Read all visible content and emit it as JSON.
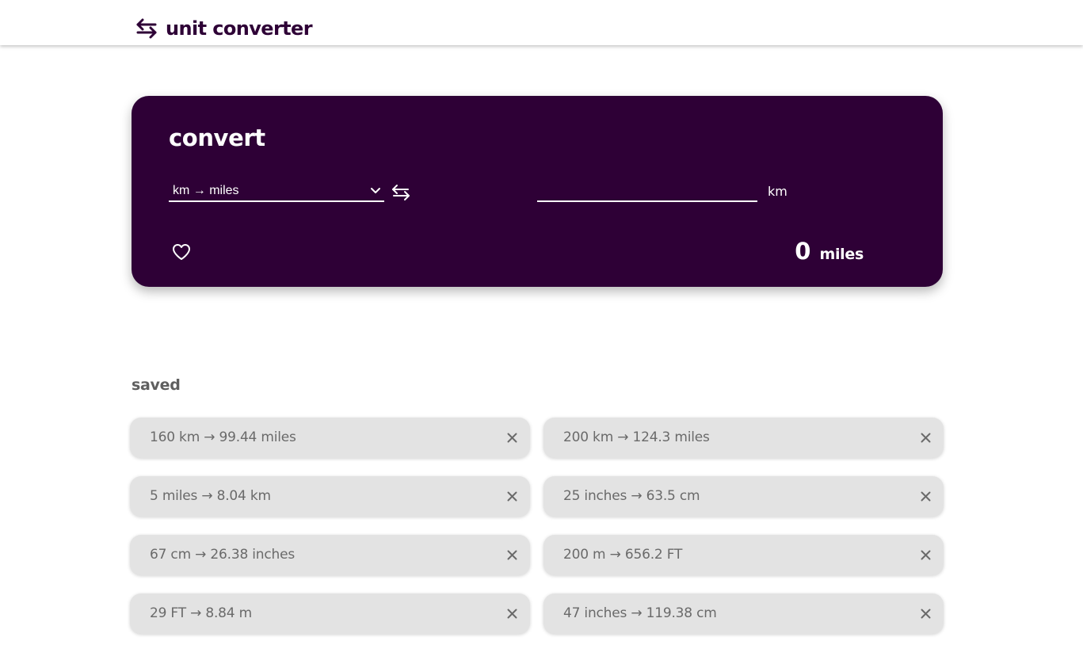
{
  "app": {
    "title": "unit converter",
    "logo_icon": "swap-arrows-icon",
    "brand_color": "#2e0036"
  },
  "converter": {
    "heading": "convert",
    "unit_pair": {
      "selected": "km → miles",
      "options": [
        "km → miles"
      ]
    },
    "swap_icon": "swap-arrows-icon",
    "input": {
      "value": "",
      "placeholder": "",
      "unit": "km"
    },
    "favorite_icon": "heart-outline-icon",
    "result": {
      "value": "0",
      "unit": "miles"
    }
  },
  "saved": {
    "heading": "saved",
    "remove_icon": "close-icon",
    "items": [
      {
        "label": "160 km → 99.44 miles"
      },
      {
        "label": "200 km → 124.3 miles"
      },
      {
        "label": "5 miles → 8.04 km"
      },
      {
        "label": "25 inches → 63.5 cm"
      },
      {
        "label": "67 cm → 26.38 inches"
      },
      {
        "label": "200 m → 656.2 FT"
      },
      {
        "label": "29 FT → 8.84 m"
      },
      {
        "label": "47 inches → 119.38 cm"
      }
    ]
  }
}
